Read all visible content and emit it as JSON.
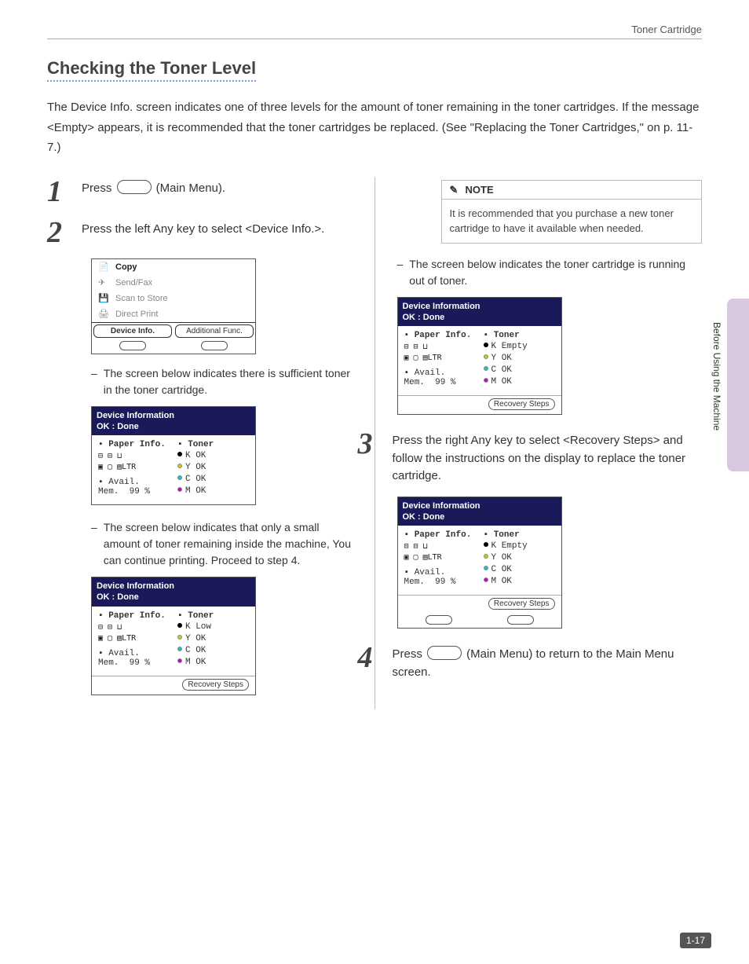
{
  "running_head": "Toner Cartridge",
  "section_title": "Checking the Toner Level",
  "intro": "The Device Info. screen indicates one of three levels for the amount of toner remaining in the toner cartridges. If the message <Empty> appears, it is recommended that the toner cartridges be replaced. (See \"Replacing the Toner Cartridges,\" on p. 11-7.)",
  "steps": {
    "s1_pre": "Press ",
    "s1_post": " (Main Menu).",
    "s2": "Press the left Any key to select <Device Info.>.",
    "s3": "Press the right Any key to select <Recovery Steps> and follow the instructions on the display to replace the toner cartridge.",
    "s4_pre": "Press ",
    "s4_post": " (Main Menu) to return to the Main Menu screen."
  },
  "subs": {
    "sufficient": "The screen below indicates there is sufficient toner in the toner cartridge.",
    "low": "The screen below indicates that only a small amount of toner remaining inside the machine, You can continue printing. Proceed to step 4.",
    "runout": "The screen below indicates the toner cartridge is running out of toner."
  },
  "menu": {
    "items": [
      "Copy",
      "Send/Fax",
      "Scan to Store",
      "Direct Print"
    ],
    "left_soft": "Device Info.",
    "right_soft": "Additional Func."
  },
  "lcd": {
    "title": "Device Information",
    "done": "OK : Done",
    "paper": "Paper Info.",
    "toner": "Toner",
    "avail": "Avail. Mem.",
    "mem_pct": "99 %",
    "ltr": "LTR",
    "recovery": "Recovery Steps",
    "k_ok": "K OK",
    "k_low": "K Low",
    "k_empty": "K Empty",
    "y_ok": "Y OK",
    "c_ok": "C OK",
    "m_ok": "M OK"
  },
  "note": {
    "label": "NOTE",
    "body": "It is recommended that you purchase a new toner cartridge to have it available when needed."
  },
  "side_tab": "Before Using the Machine",
  "page_number": "1-17"
}
